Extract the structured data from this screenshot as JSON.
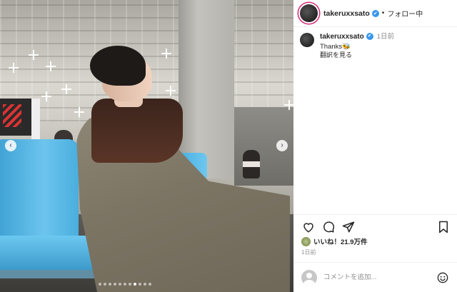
{
  "post": {
    "username": "takeruxxsato",
    "follow_state": "フォロー中",
    "separator": "•",
    "caption_username": "takeruxxsato",
    "caption_time": "1日前",
    "caption_text": "Thanks🐝",
    "translate_label": "翻訳を見る",
    "likes_text": "いいね！21.9万件",
    "post_time": "1日前",
    "comment_placeholder": "コメントを追加..."
  },
  "carousel": {
    "prev_icon": "‹",
    "next_icon": "›",
    "slides": 11,
    "active_slide": 7
  },
  "icons": {
    "verified": "✔"
  },
  "colors": {
    "story_ring": "#d62976",
    "verified": "#3897f0",
    "seat_blue": "#4aaedd"
  }
}
